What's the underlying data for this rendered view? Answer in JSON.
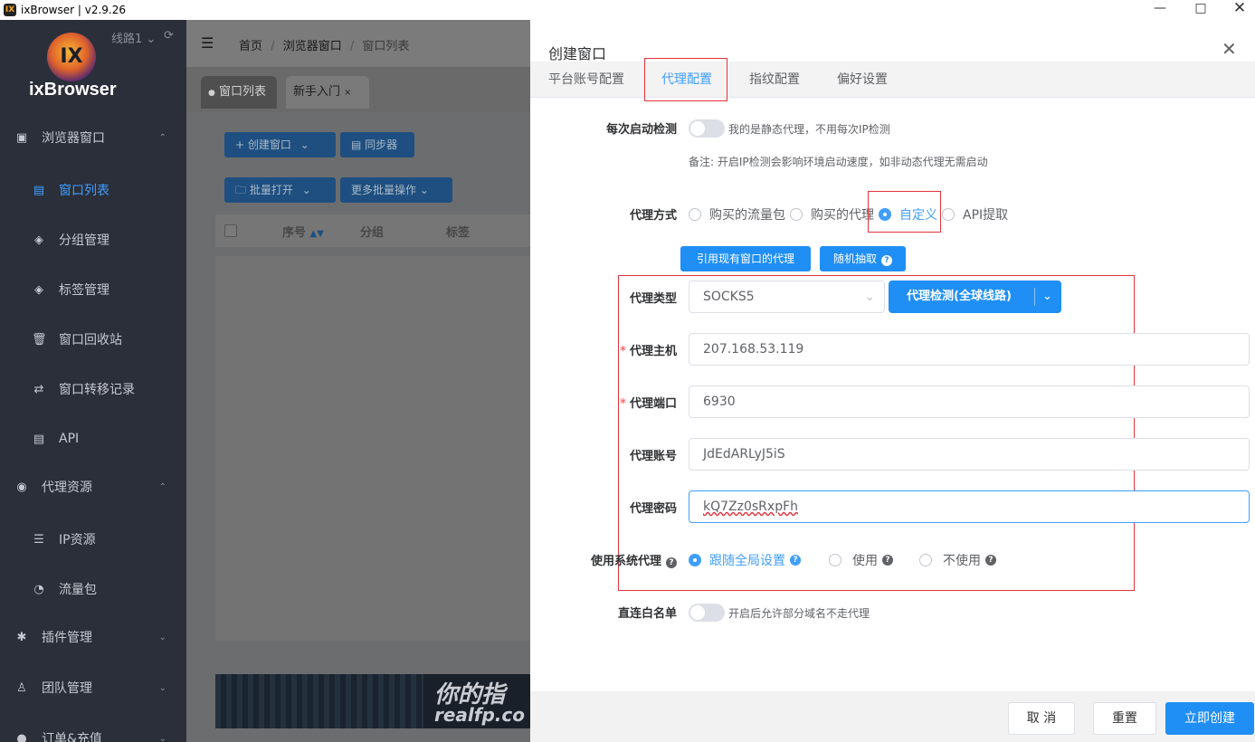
{
  "window": {
    "title": "ixBrowser | v2.9.26",
    "app_icon": "IX"
  },
  "sidebar": {
    "brand": "ixBrowser",
    "logo_text": "IX",
    "line_selector": "线路1",
    "items": [
      {
        "label": "浏览器窗口",
        "icon": "window-icon"
      },
      {
        "label": "窗口列表",
        "icon": "list-icon"
      },
      {
        "label": "分组管理",
        "icon": "layers-icon"
      },
      {
        "label": "标签管理",
        "icon": "layers-icon"
      },
      {
        "label": "窗口回收站",
        "icon": "trash-icon"
      },
      {
        "label": "窗口转移记录",
        "icon": "transfer-icon"
      },
      {
        "label": "API",
        "icon": "api-icon"
      },
      {
        "label": "代理资源",
        "icon": "globe-icon"
      },
      {
        "label": "IP资源",
        "icon": "list-icon"
      },
      {
        "label": "流量包",
        "icon": "gauge-icon"
      },
      {
        "label": "插件管理",
        "icon": "puzzle-icon"
      },
      {
        "label": "团队管理",
        "icon": "user-icon"
      },
      {
        "label": "订单&充值",
        "icon": "order-icon"
      }
    ]
  },
  "main": {
    "breadcrumb": [
      "首页",
      "浏览器窗口",
      "窗口列表"
    ],
    "tabs": [
      "窗口列表",
      "新手入门"
    ],
    "toolbar": {
      "create": "创建窗口",
      "sync": "同步器",
      "batch_open": "批量打开",
      "more_batch": "更多批量操作"
    },
    "table_headers": [
      "序号",
      "分组",
      "标签"
    ],
    "banner_text": "你的指",
    "banner_url": "realfp.co"
  },
  "drawer": {
    "title": "创建窗口",
    "tabs": [
      "平台账号配置",
      "代理配置",
      "指纹配置",
      "偏好设置"
    ],
    "startup_check": {
      "label": "每次启动检测",
      "hint": "我的是静态代理，不用每次IP检测",
      "note": "备注: 开启IP检测会影响环境启动速度，如非动态代理无需启动"
    },
    "proxy_mode": {
      "label": "代理方式",
      "options": [
        "购买的流量包",
        "购买的代理",
        "自定义",
        "API提取"
      ],
      "selected": 2
    },
    "cite_button": "引用现有窗口的代理",
    "random_button": "随机抽取",
    "proxy_type": {
      "label": "代理类型",
      "value": "SOCKS5"
    },
    "check_button": "代理检测(全球线路)",
    "host": {
      "label": "代理主机",
      "value": "207.168.53.119"
    },
    "port": {
      "label": "代理端口",
      "value": "6930"
    },
    "account": {
      "label": "代理账号",
      "value": "JdEdARLyJ5iS"
    },
    "password": {
      "label": "代理密码",
      "value": "kQ7Zz0sRxpFh"
    },
    "system_proxy": {
      "label": "使用系统代理",
      "options": [
        "跟随全局设置",
        "使用",
        "不使用"
      ],
      "selected": 0
    },
    "whitelist": {
      "label": "直连白名单",
      "hint": "开启后允许部分域名不走代理"
    },
    "footer": {
      "cancel": "取 消",
      "reset": "重置",
      "create": "立即创建"
    }
  },
  "colors": {
    "primary": "#1f8ff5",
    "sidebar": "#2b2f3a",
    "highlight_box": "#e2333b"
  }
}
